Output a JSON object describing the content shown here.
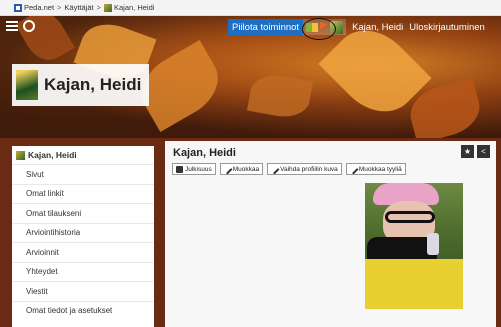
{
  "breadcrumb": {
    "site": "Peda.net",
    "section": "Käyttäjät",
    "user": "Kajan, Heidi",
    "separator": ">"
  },
  "toolbar": {
    "hide_button": "Piilota toiminnot",
    "user_name": "Kajan, Heidi",
    "logout": "Uloskirjautuminen"
  },
  "banner": {
    "title": "Kajan, Heidi"
  },
  "sidebar": {
    "header": "Kajan, Heidi",
    "items": [
      {
        "label": "Sivut"
      },
      {
        "label": "Omat linkit"
      },
      {
        "label": "Omat tilaukseni"
      },
      {
        "label": "Arviointihistoria"
      },
      {
        "label": "Arvioinnit"
      },
      {
        "label": "Yhteydet"
      },
      {
        "label": "Viestit"
      },
      {
        "label": "Omat tiedot ja asetukset"
      }
    ]
  },
  "main": {
    "title": "Kajan, Heidi",
    "icon_star": "★",
    "icon_share": "<",
    "buttons": [
      {
        "label": "Julkisuus",
        "icon": "lock-icon"
      },
      {
        "label": "Muokkaa",
        "icon": "pencil-icon"
      },
      {
        "label": "Vaihda profiilin kuva",
        "icon": "pencil-icon"
      },
      {
        "label": "Muokkaa tyyliä",
        "icon": "pencil-icon"
      }
    ]
  },
  "colors": {
    "accent": "#1e6fc4",
    "banner_bg": "#7a3216"
  }
}
